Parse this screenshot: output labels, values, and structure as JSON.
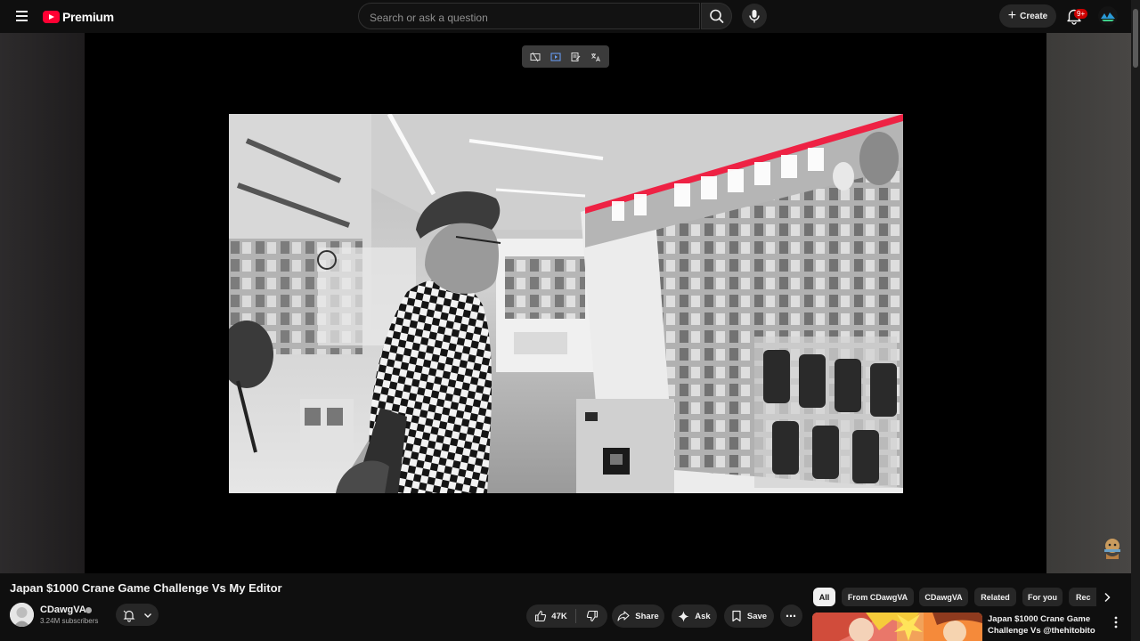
{
  "header": {
    "logo_text": "Premium",
    "search_placeholder": "Search or ask a question",
    "create_label": "Create",
    "notification_badge": "9+",
    "accent_color": "#ff0033"
  },
  "player": {
    "toolbar_icons": [
      "screenshot-icon",
      "picture-in-picture-icon",
      "notes-icon",
      "translate-icon"
    ]
  },
  "video": {
    "title": "Japan $1000 Crane Game Challenge Vs My Editor",
    "channel_name": "CDawgVA",
    "subscribers": "3.24M subscribers",
    "likes": "47K",
    "share_label": "Share",
    "ask_label": "Ask",
    "save_label": "Save"
  },
  "chips": [
    {
      "label": "All",
      "active": true
    },
    {
      "label": "From CDawgVA",
      "active": false
    },
    {
      "label": "CDawgVA",
      "active": false
    },
    {
      "label": "Related",
      "active": false
    },
    {
      "label": "For you",
      "active": false
    },
    {
      "label": "Rec",
      "active": false
    }
  ],
  "recommendation": {
    "title": "Japan $1000 Crane Game Challenge Vs @thehitobito"
  }
}
